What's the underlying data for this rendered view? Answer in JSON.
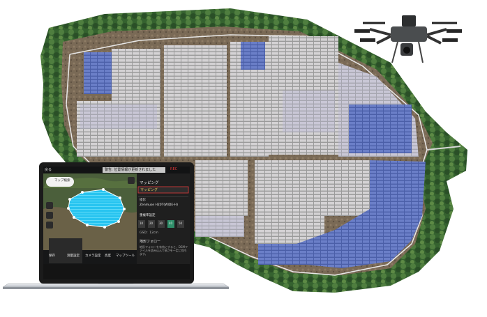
{
  "laptop_app": {
    "back_label": "戻る",
    "notice": "警告: 位置情報が更新されました",
    "rec_badge": "REC",
    "panel": {
      "mode_title": "マッピング",
      "mode_tab": "マッピング",
      "section_label": "撮影",
      "camera_name": "Zenmuse H20T(WIDE-H)",
      "overlap_label": "重複率設定",
      "overlap_options": [
        "10",
        "20",
        "30",
        "40",
        "50"
      ],
      "selected_option": "40",
      "distance_label": "GSD：12cm",
      "follow_label": "地形フォロー",
      "follow_desc": "地形フォローを有効にすると、DSMファイルを読み込んで高さを一定に保ちます。"
    },
    "map": {
      "search_label": "マップ検索"
    },
    "bottom_bar": {
      "items": [
        "保存",
        "測量設定",
        "カメラ設定",
        "高度",
        "マップツール"
      ]
    }
  },
  "colors": {
    "bg": "#ffffff",
    "forest": "#2f5a2e",
    "panel_bg": "#1f1f1f",
    "accent_red": "#e33b3b",
    "survey_area": "#27c4f0"
  }
}
